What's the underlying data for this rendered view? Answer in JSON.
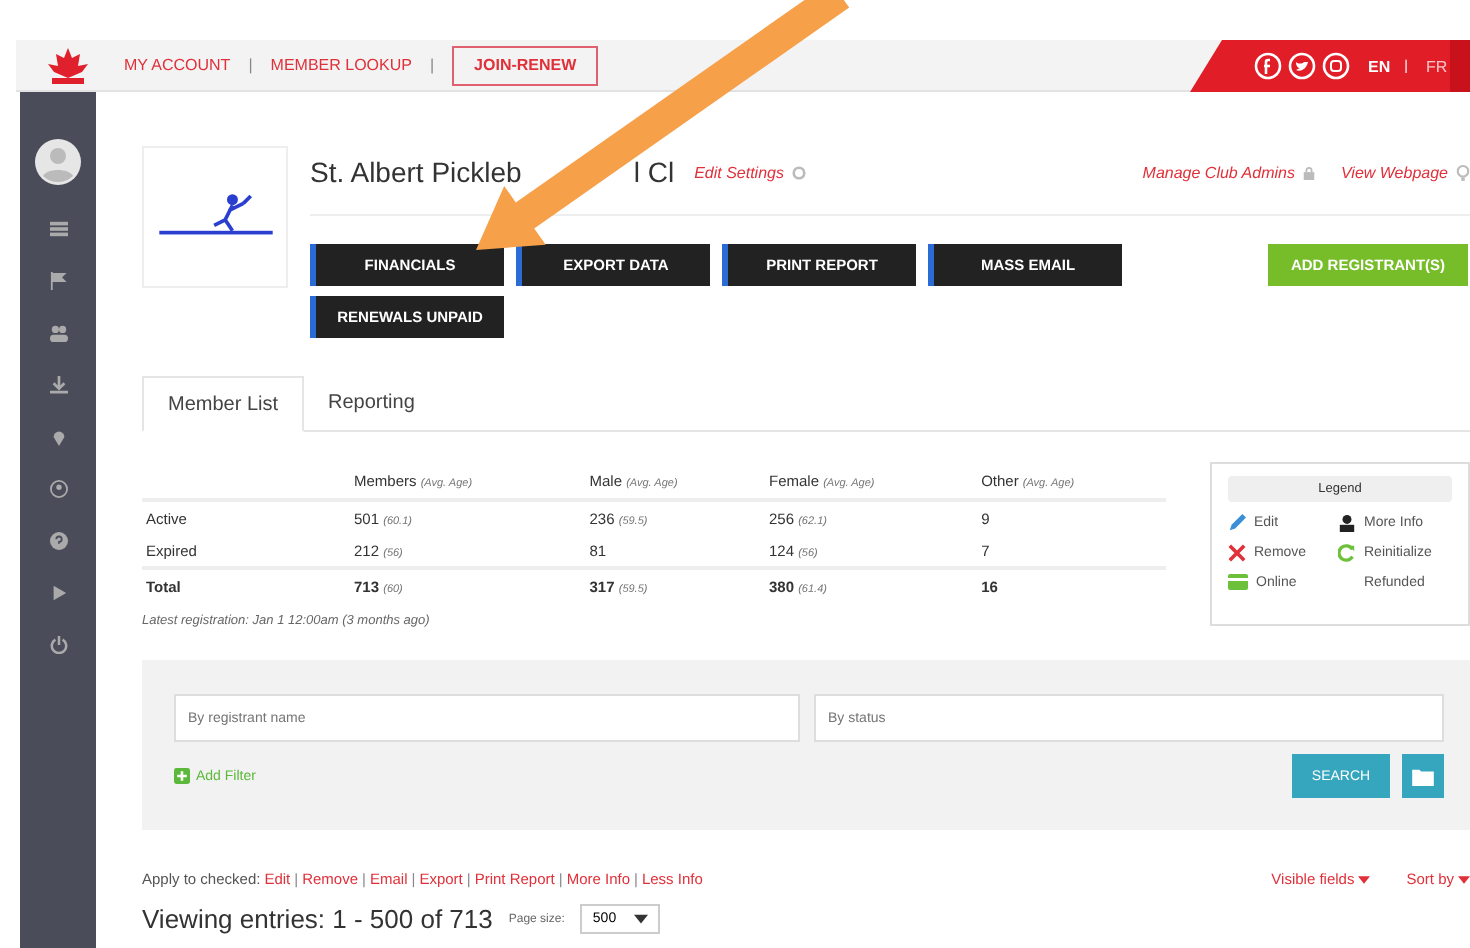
{
  "header": {
    "nav": [
      "MY ACCOUNT",
      "MEMBER LOOKUP"
    ],
    "separators": [
      "|",
      "|"
    ],
    "join": "JOIN-RENEW",
    "languages": [
      {
        "label": "EN",
        "selected": true
      },
      {
        "label": "FR",
        "selected": false
      }
    ],
    "lang_separator": "|"
  },
  "club": {
    "title_parts": [
      "St. Albert Pickleb",
      "l Cl"
    ],
    "edit_settings": "Edit Settings",
    "links": [
      "Manage Club Admins",
      "View Webpage"
    ],
    "actions": [
      {
        "label": "FINANCIALS",
        "kind": "dark"
      },
      {
        "label": "EXPORT DATA",
        "kind": "dark"
      },
      {
        "label": "PRINT REPORT",
        "kind": "dark"
      },
      {
        "label": "MASS EMAIL",
        "kind": "dark"
      },
      {
        "label": "ADD REGISTRANT(S)",
        "kind": "green"
      },
      {
        "label": "RENEWALS UNPAID",
        "kind": "dark"
      }
    ]
  },
  "tabs": [
    {
      "label": "Member List",
      "selected": true
    },
    {
      "label": "Reporting",
      "selected": false
    }
  ],
  "stats": {
    "columns": [
      {
        "label": "Members",
        "note": "(Avg. Age)"
      },
      {
        "label": "Male",
        "note": "(Avg. Age)"
      },
      {
        "label": "Female",
        "note": "(Avg. Age)"
      },
      {
        "label": "Other",
        "note": "(Avg. Age)"
      }
    ],
    "rows": [
      {
        "label": "Active",
        "kind": "normal",
        "cells": [
          {
            "value": "501",
            "note": "(60.1)"
          },
          {
            "value": "236",
            "note": "(59.5)"
          },
          {
            "value": "256",
            "note": "(62.1)"
          },
          {
            "value": "9"
          }
        ]
      },
      {
        "label": "Expired",
        "kind": "normal",
        "cells": [
          {
            "value": "212",
            "note": "(56)"
          },
          {
            "value": "81"
          },
          {
            "value": "124",
            "note": "(56)"
          },
          {
            "value": "7"
          }
        ]
      },
      {
        "label": "Total",
        "kind": "total",
        "cells": [
          {
            "value": "713",
            "note": "(60)"
          },
          {
            "value": "317",
            "note": "(59.5)"
          },
          {
            "value": "380",
            "note": "(61.4)"
          },
          {
            "value": "16"
          }
        ]
      }
    ],
    "latest": "Latest registration: Jan 1 12:00am (3 months ago)"
  },
  "legend": {
    "title": "Legend",
    "items": [
      {
        "label": "Edit",
        "kind": "edit"
      },
      {
        "label": "More Info",
        "kind": "info"
      },
      {
        "label": "Remove",
        "kind": "remove"
      },
      {
        "label": "Reinitialize",
        "kind": "reinit"
      },
      {
        "label": "Online",
        "kind": "online"
      },
      {
        "label": "Refunded",
        "kind": "refunded"
      }
    ]
  },
  "filter": {
    "name_placeholder": "By registrant name",
    "status_placeholder": "By status",
    "add_filter": "Add Filter",
    "search": "SEARCH"
  },
  "apply": {
    "label": "Apply to checked:",
    "links": [
      "Edit",
      "Remove",
      "Email",
      "Export",
      "Print Report",
      "More Info",
      "Less Info"
    ],
    "separators": [
      "|",
      "|",
      "|",
      "|",
      "|",
      "|"
    ]
  },
  "view_links": [
    "Visible fields",
    "Sort by"
  ],
  "viewing": "Viewing entries: 1 - 500 of 713",
  "page_size_label": "Page size:",
  "page_size": "500"
}
